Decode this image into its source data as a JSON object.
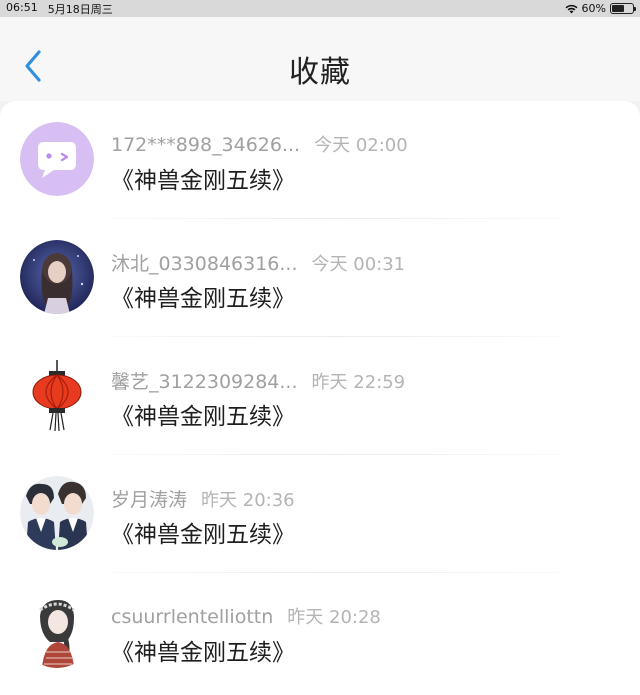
{
  "status_bar": {
    "time": "06:51",
    "date": "5月18日周三",
    "battery": "60%",
    "battery_level": 0.6
  },
  "nav": {
    "title": "收藏"
  },
  "items": [
    {
      "name": "172***898_34626...",
      "time": "今天 02:00",
      "book": "《神兽金刚五续》",
      "avatar_icon": "chat-bubble-avatar-icon"
    },
    {
      "name": "沐北_0330846316...",
      "time": "今天 00:31",
      "book": "《神兽金刚五续》",
      "avatar_icon": "anime-girl-avatar"
    },
    {
      "name": "馨艺_3122309284...",
      "time": "昨天 22:59",
      "book": "《神兽金刚五续》",
      "avatar_icon": "red-lantern-avatar"
    },
    {
      "name": "岁月涛涛",
      "time": "昨天 20:36",
      "book": "《神兽金刚五续》",
      "avatar_icon": "anime-boys-avatar"
    },
    {
      "name": "csuurrlentelliottn",
      "time": "昨天 20:28",
      "book": "《神兽金刚五续》",
      "avatar_icon": "girl-sketch-avatar"
    }
  ],
  "colors": {
    "accent": "#2f8fe0",
    "bubble_bg": "#d7bff3",
    "lantern": "#e83a1f"
  }
}
